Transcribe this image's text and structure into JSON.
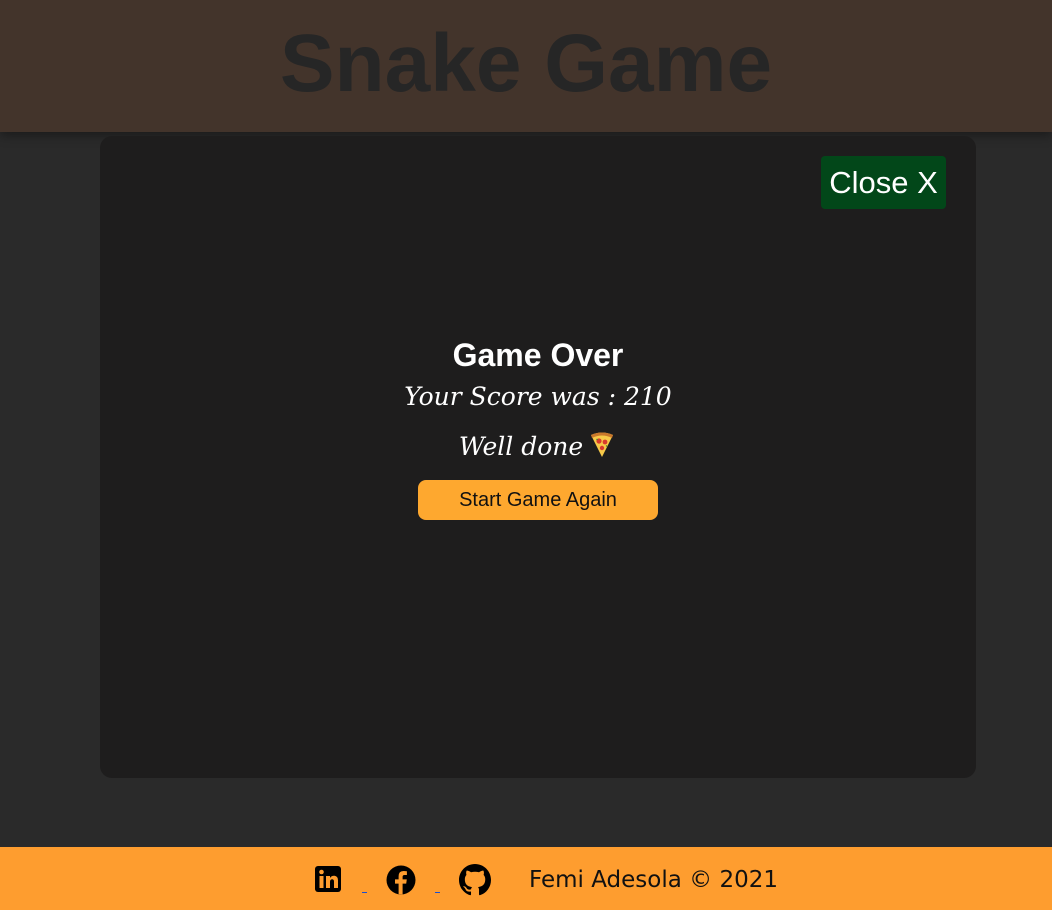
{
  "header": {
    "title": "Snake Game"
  },
  "modal": {
    "close_label": "Close X",
    "title": "Game Over",
    "score_label": "Your Score was : ",
    "score_value": "210",
    "message": "Well done",
    "message_icon": "pizza-icon",
    "start_label": "Start Game Again"
  },
  "footer": {
    "social_icons": [
      "linkedin-icon",
      "facebook-icon",
      "github-icon"
    ],
    "copyright": "Femi Adesola © 2021"
  },
  "colors": {
    "header_bg": "#43342b",
    "page_bg": "#2a2a2a",
    "modal_bg": "#1e1d1d",
    "close_button_bg": "#024719",
    "start_button_bg": "#fea82f",
    "footer_bg": "#fe9d2f"
  }
}
